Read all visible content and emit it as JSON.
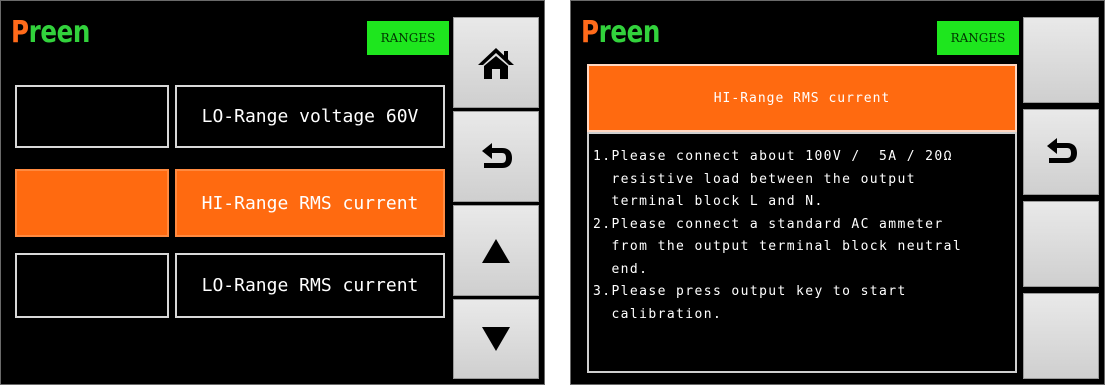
{
  "left": {
    "logo": {
      "first": "P",
      "rest": "reen"
    },
    "badge": "RANGES",
    "rows": [
      {
        "label": "LO-Range voltage 60V",
        "selected": false
      },
      {
        "label": "HI-Range RMS current",
        "selected": true
      },
      {
        "label": "LO-Range RMS current",
        "selected": false
      }
    ],
    "side_buttons": [
      "home-icon",
      "back-arrow-icon",
      "triangle-up-icon",
      "triangle-down-icon"
    ]
  },
  "right": {
    "logo": {
      "first": "P",
      "rest": "reen"
    },
    "badge": "RANGES",
    "title": "HI-Range RMS current",
    "instructions": [
      "1.Please connect about 100V /  5A / 20Ω",
      "  resistive load between the output",
      "  terminal block L and N.",
      "2.Please connect a standard AC ammeter",
      "  from the output terminal block neutral",
      "  end.",
      "3.Please press output key to start",
      "  calibration."
    ],
    "side_buttons": [
      "blank",
      "back-arrow-icon",
      "blank",
      "blank"
    ]
  },
  "colors": {
    "accent_orange": "#ff6a10",
    "badge_green": "#1ee61e",
    "logo_green": "#32d23c"
  }
}
